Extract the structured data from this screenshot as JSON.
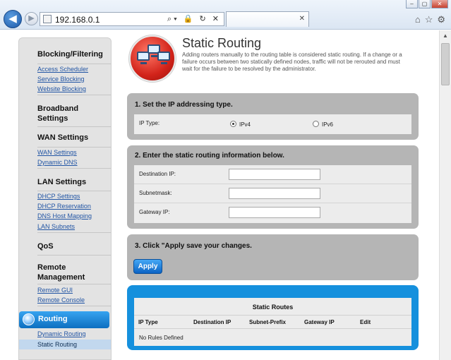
{
  "browser": {
    "url": "192.168.0.1",
    "address_tools": "⌕▾ 🔒 ↻ ✕",
    "tab_close": "✕",
    "window": {
      "minimize": "–",
      "maximize": "▢",
      "close": "✕"
    }
  },
  "sidebar": {
    "sections": [
      {
        "title": "Blocking/Filtering",
        "links": [
          "Access Scheduler",
          "Service Blocking",
          "Website Blocking"
        ]
      },
      {
        "title": "Broadband Settings",
        "links": []
      },
      {
        "title": "WAN Settings",
        "links": [
          "WAN Settings",
          "Dynamic DNS"
        ]
      },
      {
        "title": "LAN Settings",
        "links": [
          "DHCP Settings",
          "DHCP Reservation",
          "DNS Host Mapping",
          "LAN Subnets"
        ]
      },
      {
        "title": "QoS",
        "links": []
      },
      {
        "title": "Remote Management",
        "links": [
          "Remote GUI",
          "Remote Console"
        ]
      },
      {
        "title": "Routing",
        "links": [
          "Dynamic Routing",
          "Static Routing"
        ]
      }
    ],
    "active_section": "Routing",
    "active_link": "Static Routing"
  },
  "page": {
    "title": "Static Routing",
    "description": "Adding routers manually to the routing table is considered static routing. If a change or a failure occurs between two statically defined nodes, traffic will not be rerouted and must wait for the failure to be resolved by the administrator."
  },
  "step1": {
    "title": "1. Set the IP addressing type.",
    "ip_type_label": "IP Type:",
    "options": [
      "IPv4",
      "IPv6"
    ],
    "selected": "IPv4"
  },
  "step2": {
    "title": "2. Enter the static routing information below.",
    "fields": [
      {
        "label": "Destination IP:",
        "value": ""
      },
      {
        "label": "Subnetmask:",
        "value": ""
      },
      {
        "label": "Gateway IP:",
        "value": ""
      }
    ]
  },
  "step3": {
    "title": "3. Click \"Apply save your changes.",
    "apply_label": "Apply"
  },
  "static_routes": {
    "title": "Static Routes",
    "columns": [
      "IP Type",
      "Destination IP",
      "Subnet-Prefix",
      "Gateway IP",
      "Edit"
    ],
    "empty_text": "No Rules Defined"
  },
  "colors": {
    "accent_blue": "#1590dd",
    "panel_gray": "#b5b5b5",
    "link_blue": "#2255a4"
  }
}
